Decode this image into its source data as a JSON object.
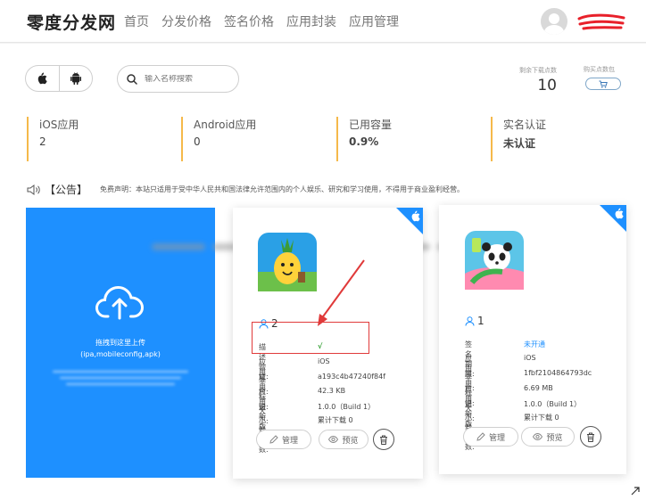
{
  "brand": "零度分发网",
  "nav": [
    "首页",
    "分发价格",
    "签名价格",
    "应用封装",
    "应用管理"
  ],
  "search_placeholder": "输入名称搜索",
  "downloads_label": "剩余下载点数",
  "downloads_value": "10",
  "buy_label": "购买点数包",
  "stats": [
    {
      "label": "iOS应用",
      "value": "2"
    },
    {
      "label": "Android应用",
      "value": "0"
    },
    {
      "label": "已用容量",
      "value": "0.9%"
    },
    {
      "label": "实名认证",
      "value": "未认证"
    }
  ],
  "notice_title": "【公告】",
  "notice_text": "免费声明：本站只适用于受中华人民共和国法律允许范围内的个人娱乐、研究和学习使用，不得用于商业盈利经营。",
  "upload": {
    "line1": "拖拽到这里上传",
    "line2": "(ipa,mobileconfig,apk)"
  },
  "cards": [
    {
      "count": "2",
      "rows": [
        {
          "k": "描述验证:",
          "v": "√"
        },
        {
          "k": "应用平台:",
          "v": "iOS"
        },
        {
          "k": "应用标识:",
          "v": "a193c4b47240f84f"
        },
        {
          "k": "应用大小:",
          "v": "42.3 KB"
        },
        {
          "k": "最新版本:",
          "v": "1.0.0（Build 1）"
        },
        {
          "k": "下载次数:",
          "v": "累计下载 0"
        }
      ],
      "manage": "管理",
      "preview": "预览"
    },
    {
      "count": "1",
      "rows": [
        {
          "k": "签名期限:",
          "v": "未开通"
        },
        {
          "k": "应用平台:",
          "v": "iOS"
        },
        {
          "k": "应用标识:",
          "v": "1fbf2104864793dc"
        },
        {
          "k": "应用大小:",
          "v": "6.69 MB"
        },
        {
          "k": "最新版本:",
          "v": "1.0.0（Build 1）"
        },
        {
          "k": "下载次数:",
          "v": "累计下载 0"
        }
      ],
      "manage": "管理",
      "preview": "预览"
    }
  ],
  "colors": {
    "accent": "#1e90ff",
    "stat_border": "#f5b94a",
    "annotation": "#e03a3a",
    "link": "#1e90ff"
  }
}
